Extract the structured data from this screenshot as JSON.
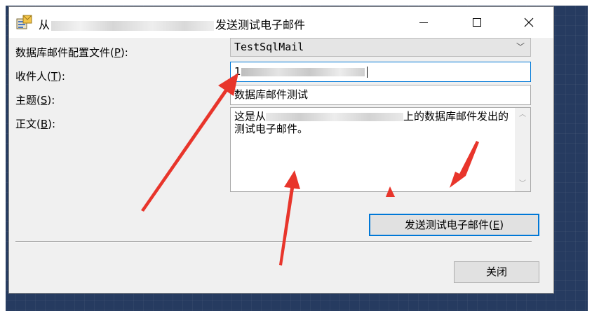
{
  "window": {
    "title_prefix": "从",
    "title_suffix": "发送测试电子邮件"
  },
  "form": {
    "profile_label": "数据库邮件配置文件(",
    "profile_key": "P",
    "profile_label_end": "):",
    "profile_value": "TestSqlMail",
    "recipient_label": "收件人(",
    "recipient_key": "T",
    "recipient_label_end": "):",
    "recipient_visible_prefix": "1",
    "subject_label": "主题(",
    "subject_key": "S",
    "subject_label_end": "):",
    "subject_value": "数据库邮件测试",
    "body_label": "正文(",
    "body_key": "B",
    "body_label_end": "):",
    "body_prefix": "这是从",
    "body_suffix": "上的数据库邮件发出的测试电子邮件。"
  },
  "buttons": {
    "send_label": "发送测试电子邮件(",
    "send_key": "E",
    "send_label_end": ")",
    "close_label": "关闭"
  },
  "colors": {
    "annotation_arrow": "#e8352b",
    "focus_border": "#0078d7",
    "desktop_background": "#263b60"
  }
}
